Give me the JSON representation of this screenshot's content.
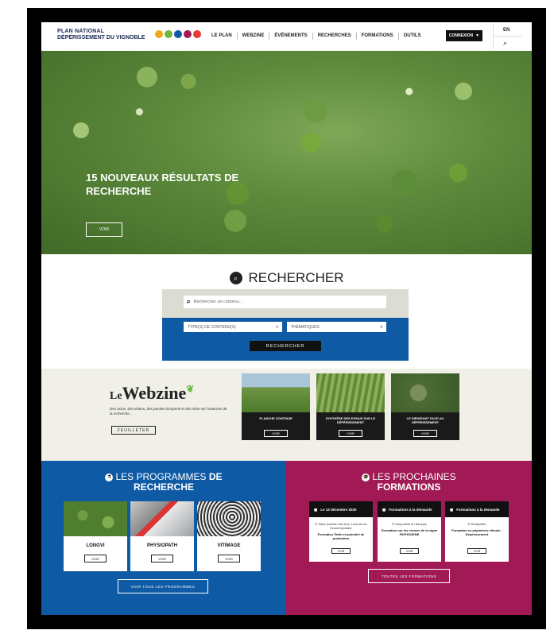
{
  "header": {
    "logo_line1": "PLAN NATIONAL",
    "logo_line2": "DÉPÉRISSEMENT DU VIGNOBLE",
    "nav": [
      "LE PLAN",
      "WEBZINE",
      "ÉVÉNEMENTS",
      "RECHERCHES",
      "FORMATIONS",
      "OUTILS"
    ],
    "connexion": "CONNEXION",
    "lang": "EN"
  },
  "hero": {
    "title": "15 NOUVEAUX RÉSULTATS DE RECHERCHE",
    "button": "VOIR"
  },
  "search": {
    "title": "RECHERCHER",
    "placeholder": "Rechercher un contenu...",
    "type_select": "TYPE(S) DE CONTENU(S)",
    "theme_select": "THÉMATIQUES",
    "button": "RECHERCHER"
  },
  "webzine": {
    "logo_le": "Le",
    "logo_main": "Webzine",
    "description": "Des actus, des vidéos, des paroles d'experts et des infos sur l'avancée de la recherche...",
    "button": "FEUILLETER",
    "cards": [
      {
        "title": "PLANCHE CONTINUE",
        "button": "VOIR"
      },
      {
        "title": "SYNTHÈSE DES ESSAIS SUR LE DÉPÉRISSEMENT",
        "button": "VOIR"
      },
      {
        "title": "LE DIRIGEANT FACE AU DÉPÉRISSEMENT",
        "button": "VOIR"
      }
    ]
  },
  "programmes": {
    "title_a": "LES PROGRAMMES",
    "title_b": "DE",
    "title_c": "RECHERCHE",
    "cards": [
      {
        "title": "LONGVI",
        "button": "VOIR"
      },
      {
        "title": "PHYSIOPATH",
        "button": "VOIR"
      },
      {
        "title": "VITIMAGE",
        "button": "VOIR"
      }
    ],
    "all_button": "VOIR TOUS LES PROGRAMMES"
  },
  "formations": {
    "title_a": "LES PROCHAINES",
    "title_b": "FORMATIONS",
    "cards": [
      {
        "date": "Le 13 décembre 2020",
        "location": "Saint Quentin des Iles, Lucerne du Grand Ayrolaire",
        "title": "Formation Taille et potentiel de production",
        "button": "VOIR"
      },
      {
        "date": "Formations à la demande",
        "location": "Disponible en français",
        "title": "Formation sur les viroses de la vigne PATHOGENE",
        "button": "VOIR"
      },
      {
        "date": "Formations à la demande",
        "location": "Montpellier",
        "title": "Formation en pépinières viticole : Dépérissement",
        "button": "VOIR"
      }
    ],
    "all_button": "TOUTES LES FORMATIONS"
  }
}
